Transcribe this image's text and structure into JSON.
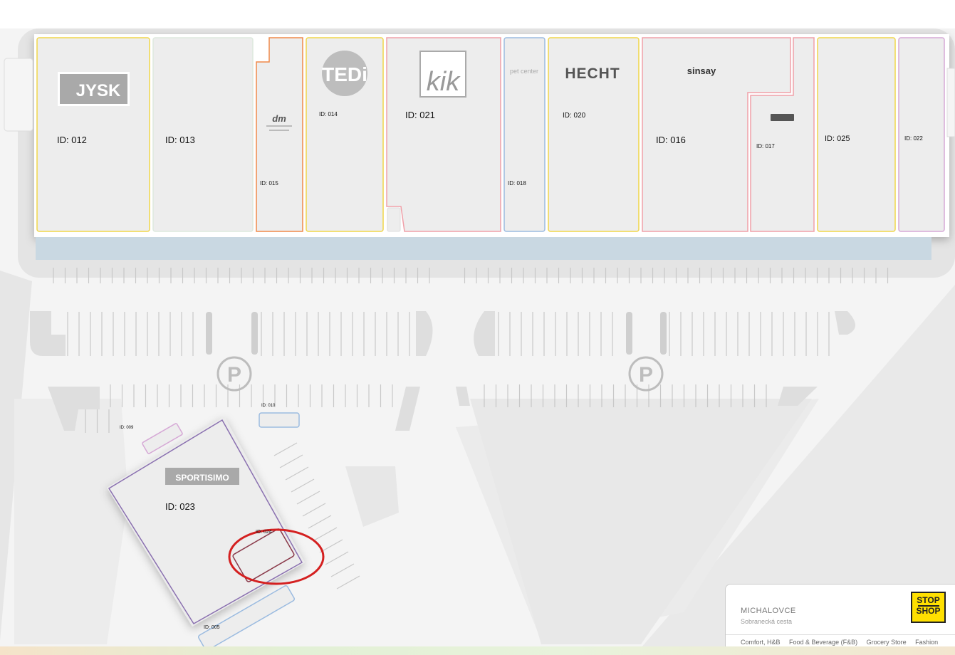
{
  "stores": [
    {
      "id": "ID: 012",
      "brand": "JYSK"
    },
    {
      "id": "ID: 013",
      "brand": ""
    },
    {
      "id": "ID: 015",
      "brand": "dm"
    },
    {
      "id": "ID: 014",
      "brand": "TEDi"
    },
    {
      "id": "ID: 021",
      "brand": "kik"
    },
    {
      "id": "ID: 018",
      "brand": "pet center"
    },
    {
      "id": "ID: 020",
      "brand": "HECHT"
    },
    {
      "id": "ID: 016",
      "brand": "sinsay"
    },
    {
      "id": "ID: 017",
      "brand": ""
    },
    {
      "id": "ID: 025",
      "brand": ""
    },
    {
      "id": "ID: 022",
      "brand": ""
    },
    {
      "id": "ID: 010",
      "brand": ""
    },
    {
      "id": "ID: 009",
      "brand": ""
    },
    {
      "id": "ID: 023",
      "brand": "SPORTISIMO"
    },
    {
      "id": "ID: 024",
      "brand": ""
    },
    {
      "id": "ID: 005",
      "brand": ""
    }
  ],
  "parking_symbol": "P",
  "info_panel": {
    "city": "MICHALOVCE",
    "street": "Sobranecká cesta",
    "logo_top": "STOP",
    "logo_bottom": "SHOP",
    "categories": [
      "Comfort, H&B",
      "Food & Beverage (F&B)",
      "Grocery Store",
      "Fashion"
    ]
  },
  "colors": {
    "unit_fill": "#ededed",
    "yellow": "#f0d64a",
    "orange": "#f08a4a",
    "pink": "#f0a0a8",
    "blue": "#9bbbe0",
    "lilac": "#d6a9d6",
    "purple": "#8a70b0",
    "maroon": "#8a3a4a",
    "highlight": "#d42020"
  }
}
